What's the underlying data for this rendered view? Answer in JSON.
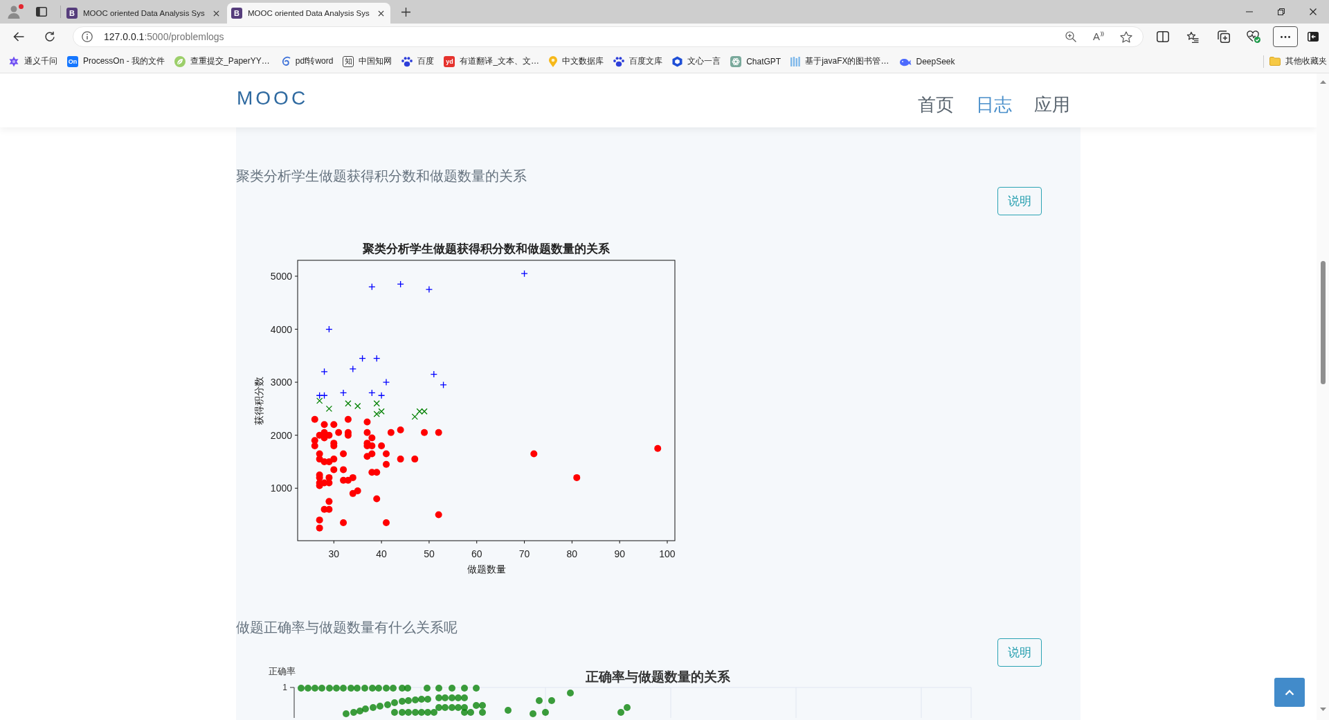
{
  "tabs": [
    {
      "favicon": "B",
      "title": "MOOC oriented Data Analysis Sys",
      "selected": false
    },
    {
      "favicon": "B",
      "title": "MOOC oriented Data Analysis Sys",
      "selected": true
    }
  ],
  "address_bar": {
    "host": "127.0.0.1",
    "path": ":5000/problemlogs",
    "read_aloud_letter": "A"
  },
  "bookmarks": [
    {
      "label": "通义千问"
    },
    {
      "label": "ProcessOn - 我的文件",
      "icon_text": "On"
    },
    {
      "label": "查重提交_PaperYY…"
    },
    {
      "label": "pdf转word"
    },
    {
      "label": "中国知网",
      "icon_text": "知"
    },
    {
      "label": "百度"
    },
    {
      "label": "有道翻译_文本、文…",
      "icon_text": "yd"
    },
    {
      "label": "中文数据库"
    },
    {
      "label": "百度文库"
    },
    {
      "label": "文心一言"
    },
    {
      "label": "ChatGPT"
    },
    {
      "label": "基于javaFX的图书管…"
    },
    {
      "label": "DeepSeek"
    }
  ],
  "other_bookmarks": {
    "label": "其他收藏夹"
  },
  "navbar": {
    "logo": "MOOC",
    "links": [
      {
        "label": "首页",
        "selected": false
      },
      {
        "label": "日志",
        "selected": true
      },
      {
        "label": "应用",
        "selected": false
      }
    ]
  },
  "sections": [
    {
      "kind": "scatter",
      "title": "聚类分析学生做题获得积分数和做题数量的关系",
      "button": "说明",
      "chart_data": {
        "type": "scatter",
        "title": "聚类分析学生做题获得积分数和做题数量的关系",
        "xlabel": "做题数量",
        "ylabel": "获得积分数",
        "xlim": [
          22.4,
          101.6
        ],
        "ylim": [
          10,
          5300
        ],
        "xticks": [
          30,
          40,
          50,
          60,
          70,
          80,
          90,
          100
        ],
        "yticks": [
          1000,
          2000,
          3000,
          4000,
          5000
        ],
        "series": [
          {
            "color": "#0000ff",
            "marker": "plus",
            "x": [
              70,
              38,
              44,
              50,
              29,
              36,
              39,
              28,
              34,
              41,
              51,
              53,
              27,
              28,
              32,
              38,
              40
            ],
            "values": [
              5050,
              4800,
              4850,
              4750,
              4000,
              3450,
              3450,
              3200,
              3250,
              3000,
              3150,
              2950,
              2750,
              2750,
              2800,
              2800,
              2750
            ]
          },
          {
            "color": "#008000",
            "marker": "x",
            "x": [
              27,
              29,
              33,
              35,
              39,
              39,
              40,
              47,
              48,
              49
            ],
            "values": [
              2650,
              2500,
              2600,
              2550,
              2600,
              2400,
              2450,
              2350,
              2450,
              2450
            ]
          },
          {
            "color": "#ff0000",
            "marker": "circle",
            "x": [
              26,
              26,
              26,
              27,
              28,
              28,
              28,
              29,
              30,
              30,
              30,
              31,
              33,
              33,
              33,
              37,
              37,
              37,
              37,
              38,
              38,
              40,
              42,
              44,
              49,
              52,
              27,
              27,
              28,
              29,
              30,
              30,
              32,
              32,
              32,
              33,
              34,
              37,
              38,
              38,
              39,
              41,
              41,
              44,
              47,
              72,
              81,
              98,
              27,
              27,
              27,
              27,
              28,
              29,
              29,
              34,
              35,
              39,
              29,
              28,
              29,
              27,
              27,
              32,
              41,
              52
            ],
            "values": [
              2300,
              1900,
              1800,
              2000,
              2200,
              2050,
              1950,
              2000,
              2200,
              1850,
              1800,
              2050,
              2300,
              2050,
              2000,
              2250,
              2050,
              1850,
              1800,
              1950,
              1800,
              1800,
              2050,
              2100,
              2050,
              2050,
              1650,
              1550,
              1500,
              1500,
              1550,
              1350,
              1650,
              1350,
              1150,
              1150,
              1200,
              1600,
              1650,
              1300,
              1300,
              1650,
              1450,
              1550,
              1550,
              1650,
              1200,
              1750,
              1250,
              1200,
              1100,
              1050,
              1100,
              1200,
              1100,
              900,
              950,
              800,
              750,
              600,
              600,
              400,
              250,
              350,
              350,
              500
            ]
          }
        ]
      }
    },
    {
      "kind": "picture",
      "title": "做题正确率与做题数量有什么关系呢",
      "button": "说明",
      "chart": {
        "title": "正确率与做题数量的关系",
        "ylabel": "正确率",
        "yticks": [
          "1"
        ]
      }
    }
  ]
}
